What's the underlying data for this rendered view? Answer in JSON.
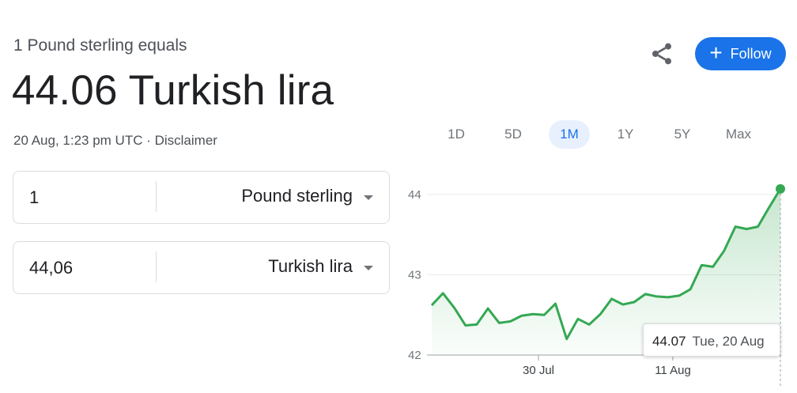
{
  "header": {
    "subtitle": "1 Pound sterling equals",
    "rate_value": "44.06",
    "rate_currency": "Turkish lira",
    "timestamp": "20 Aug, 1:23 pm UTC",
    "separator": " · ",
    "disclaimer": "Disclaimer"
  },
  "actions": {
    "share_icon": "share-icon",
    "follow_label": "Follow",
    "follow_icon": "plus-icon",
    "accent": "#1a73e8"
  },
  "converter": {
    "from_amount": "1",
    "from_currency": "Pound sterling",
    "to_amount": "44,06",
    "to_currency": "Turkish lira"
  },
  "range_tabs": [
    "1D",
    "5D",
    "1M",
    "1Y",
    "5Y",
    "Max"
  ],
  "active_tab": "1M",
  "tooltip": {
    "value": "44.07",
    "date": "Tue, 20 Aug"
  },
  "chart_data": {
    "type": "area",
    "title": "",
    "xlabel": "",
    "ylabel": "",
    "ylim": [
      42,
      44.1
    ],
    "y_ticks": [
      42,
      43,
      44
    ],
    "x_tick_labels": [
      "30 Jul",
      "11 Aug"
    ],
    "grid": true,
    "line_color": "#34a853",
    "series": [
      {
        "values": [
          42.62,
          42.77,
          42.59,
          42.37,
          42.38,
          42.58,
          42.4,
          42.42,
          42.49,
          42.51,
          42.5,
          42.64,
          42.2,
          42.45,
          42.38,
          42.51,
          42.7,
          42.63,
          42.66,
          42.76,
          42.73,
          42.72,
          42.74,
          42.82,
          43.12,
          43.1,
          43.3,
          43.6,
          43.57,
          43.6,
          43.84,
          44.07
        ]
      }
    ]
  }
}
